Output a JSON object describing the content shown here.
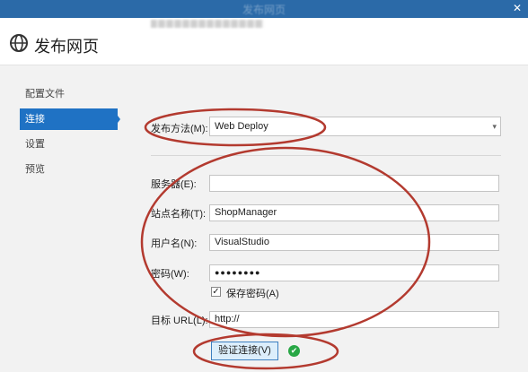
{
  "window": {
    "title": "发布网页",
    "close_glyph": "✕"
  },
  "header": {
    "title": "发布网页",
    "icon": "globe-icon"
  },
  "sidebar": {
    "items": [
      {
        "label": "配置文件",
        "active": false
      },
      {
        "label": "连接",
        "active": true
      },
      {
        "label": "设置",
        "active": false
      },
      {
        "label": "预览",
        "active": false
      }
    ]
  },
  "form": {
    "method_label": "发布方法(M):",
    "method_value": "Web Deploy",
    "server_label": "服务器(E):",
    "server_value": "",
    "site_label": "站点名称(T):",
    "site_value": "ShopManager",
    "user_label": "用户名(N):",
    "user_value": "VisualStudio",
    "password_label": "密码(W):",
    "password_value": "●●●●●●●●",
    "save_password_label": "保存密码(A)",
    "save_password_checked": true,
    "target_label": "目标 URL(L):",
    "target_value": "http://",
    "validate_button": "验证连接(V)"
  },
  "colors": {
    "accent": "#1f72c4",
    "annotation": "#b33a2f",
    "success": "#28a745"
  }
}
